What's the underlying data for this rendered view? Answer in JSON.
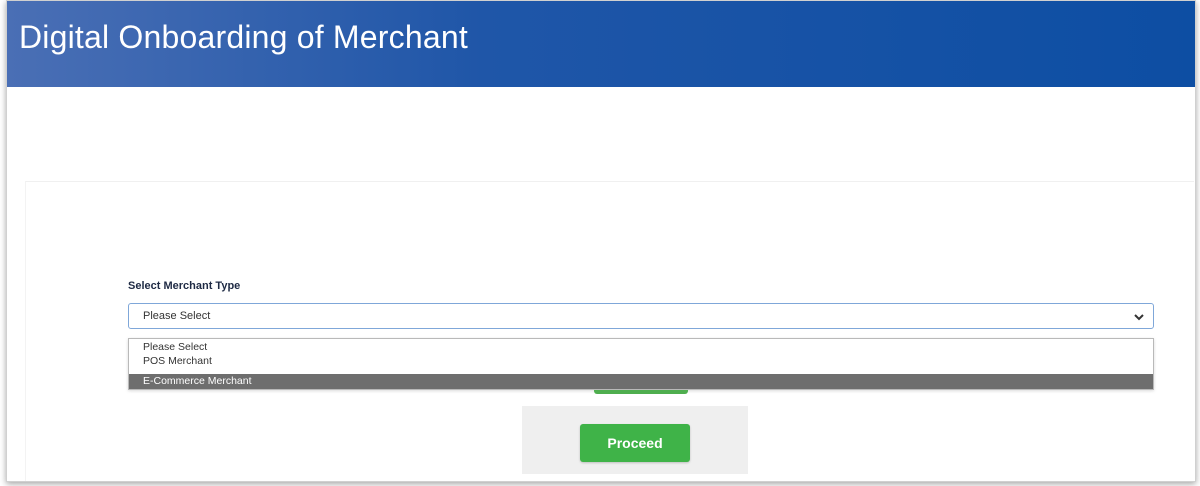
{
  "header": {
    "title": "Digital Onboarding of Merchant",
    "color": "#1f56a8"
  },
  "form": {
    "label": "Select Merchant Type",
    "select": {
      "selected_value": "Please Select",
      "options": [
        "Please Select",
        "POS Merchant",
        "E-Commerce Merchant"
      ],
      "highlighted_option": "E-Commerce Merchant",
      "icon": "chevron-down-icon"
    },
    "proceed_label": "Proceed",
    "proceed_color": "#3fb348"
  }
}
